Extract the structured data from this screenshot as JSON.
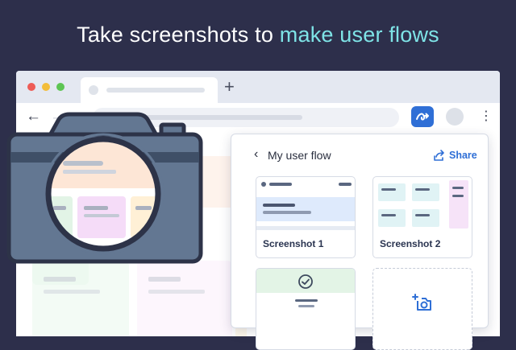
{
  "headline": {
    "lead": "Take screenshots to ",
    "accent": "make user flows"
  },
  "browser": {
    "newtab_symbol": "+",
    "back_symbol": "←",
    "forward_symbol": "→",
    "menu_symbol": "⋮"
  },
  "popup": {
    "back_symbol": "‹",
    "title": "My user flow",
    "share_label": "Share",
    "screenshots": [
      {
        "label": "Screenshot 1"
      },
      {
        "label": "Screenshot 2"
      }
    ]
  },
  "colors": {
    "background": "#2d2f4b",
    "accent": "#7ee3e6",
    "brand_blue": "#2f6fd6",
    "camera": "#637792"
  },
  "icons": [
    "arrow-left-icon",
    "arrow-right-icon",
    "plus-icon",
    "extension-flow-icon",
    "avatar",
    "kebab-menu-icon",
    "chevron-left-icon",
    "share-icon",
    "check-circle-icon",
    "add-photo-icon",
    "camera-icon"
  ]
}
